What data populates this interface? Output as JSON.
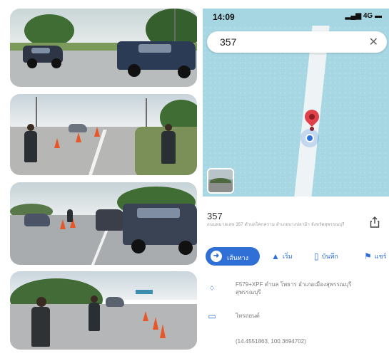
{
  "status_bar": {
    "time": "14:09",
    "indicators": "4G"
  },
  "search": {
    "query": "357"
  },
  "place": {
    "title": "357",
    "subtitle": "ถนนหมายเลข 357 ตำบลโคกคราม อำเภอบางปลาม้า จังหวัดสุพรรณบุรี"
  },
  "actions": {
    "directions": "เส้นทาง",
    "start": "เริ่ม",
    "save": "บันทึก",
    "more": "แชร์"
  },
  "details": {
    "plus_code": "F579+XPF ตำบล โพธาร อำเภอเมืองสุพรรณบุรี สุพรรณบุรี",
    "type": "ไทรถยนต์",
    "coordinates": "(14.4551863, 100.3694702)"
  },
  "colors": {
    "accent": "#2f6fd6",
    "map_water": "#a7d7e3",
    "pin": "#e0424b"
  },
  "icons": {
    "location": "navigation-arrow-icon",
    "plus_code": "plus-code-icon",
    "type": "card-icon"
  }
}
